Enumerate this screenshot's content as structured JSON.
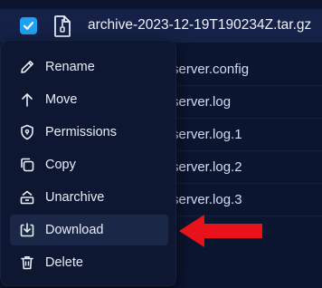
{
  "files": [
    {
      "name": "archive-2023-12-19T190234Z.tar.gz",
      "selected": true
    },
    {
      "name": "server.config",
      "selected": false
    },
    {
      "name": "server.log",
      "selected": false
    },
    {
      "name": "server.log.1",
      "selected": false
    },
    {
      "name": "server.log.2",
      "selected": false
    },
    {
      "name": "server.log.3",
      "selected": false
    }
  ],
  "context_menu": {
    "items": [
      {
        "label": "Rename",
        "icon": "pencil-icon"
      },
      {
        "label": "Move",
        "icon": "arrow-up-icon"
      },
      {
        "label": "Permissions",
        "icon": "shield-icon"
      },
      {
        "label": "Copy",
        "icon": "copy-icon"
      },
      {
        "label": "Unarchive",
        "icon": "unarchive-icon"
      },
      {
        "label": "Download",
        "icon": "download-icon",
        "active": true
      },
      {
        "label": "Delete",
        "icon": "trash-icon"
      }
    ]
  },
  "colors": {
    "background": "#0b1530",
    "menu_background": "#0e1731",
    "checkbox": "#1da1f2",
    "annotation_arrow": "#e8121b"
  }
}
